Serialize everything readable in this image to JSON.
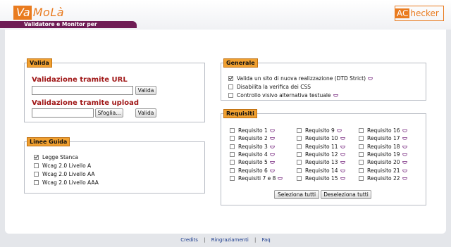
{
  "header": {
    "logo_prefix": "Va",
    "logo_suffix": "MoLà",
    "tagline": "Validatore e Monitor per l'Accessibilità",
    "right_logo_prefix": "AC",
    "right_logo_suffix": "hecker"
  },
  "valida": {
    "legend": "Valida",
    "url_label": "Validazione tramite URL",
    "url_value": "",
    "url_button": "Valida",
    "upload_label": "Validazione tramite upload",
    "browse_button": "Sfoglia...",
    "upload_button": "Valida"
  },
  "linee_guida": {
    "legend": "Linee Guida",
    "options": [
      {
        "label": "Legge Stanca",
        "checked": true
      },
      {
        "label": "Wcag 2.0 Livello A",
        "checked": false
      },
      {
        "label": "Wcag 2.0 Livello AA",
        "checked": false
      },
      {
        "label": "Wcag 2.0 Livello AAA",
        "checked": false
      }
    ]
  },
  "generale": {
    "legend": "Generale",
    "options": [
      {
        "label": "Valida un sito di nuova realizzazione (DTD Strict)",
        "checked": true,
        "info": true
      },
      {
        "label": "Disabilita la verifica dei CSS",
        "checked": false,
        "info": false
      },
      {
        "label": "Controllo visivo alternativa testuale",
        "checked": false,
        "info": true
      }
    ]
  },
  "requisiti": {
    "legend": "Requisiti",
    "items": [
      "Requisito 1",
      "Requisito 2",
      "Requisito 3",
      "Requisito 4",
      "Requisito 5",
      "Requisito 6",
      "Requisiti 7 e 8",
      "Requisito 9",
      "Requisito 10",
      "Requisito 11",
      "Requisito 12",
      "Requisito 13",
      "Requisito 14",
      "Requisito 15",
      "Requisito 16",
      "Requisito 17",
      "Requisito 18",
      "Requisito 19",
      "Requisito 20",
      "Requisito 21",
      "Requisito 22"
    ],
    "select_all": "Seleziona tutti",
    "deselect_all": "Deseleziona tutti"
  },
  "footer": {
    "credits": "Credits",
    "sep": "|",
    "thanks": "Ringraziamenti",
    "faq": "Faq"
  }
}
